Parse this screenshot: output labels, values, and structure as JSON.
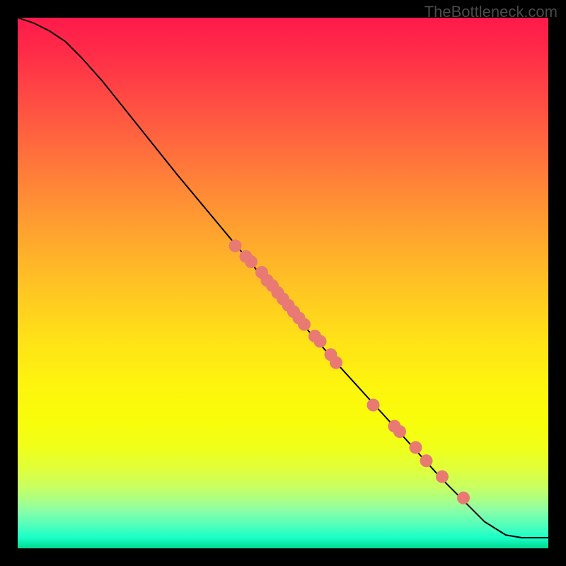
{
  "watermark": "TheBottleneck.com",
  "chart_data": {
    "type": "line",
    "title": "",
    "xlabel": "",
    "ylabel": "",
    "xlim": [
      0,
      100
    ],
    "ylim": [
      0,
      100
    ],
    "curve": {
      "name": "bottleneck-curve",
      "x": [
        0,
        3,
        6,
        9,
        12,
        16,
        22,
        30,
        40,
        50,
        60,
        70,
        80,
        88,
        92,
        95,
        100
      ],
      "y": [
        100,
        99,
        97.5,
        95.5,
        92.5,
        88,
        80.5,
        70.5,
        58.5,
        46.5,
        35,
        24,
        13,
        5,
        2.5,
        2,
        2
      ]
    },
    "points": {
      "name": "component-points",
      "x": [
        41,
        43,
        44,
        46,
        47,
        48,
        49,
        50,
        51,
        52,
        53,
        54,
        56,
        57,
        59,
        60,
        67,
        71,
        72,
        75,
        77,
        80,
        84
      ],
      "y": [
        57,
        55,
        54,
        52,
        50.5,
        49.5,
        48.2,
        47,
        45.8,
        44.6,
        43.4,
        42.2,
        40,
        39,
        36.5,
        35,
        27,
        23,
        22,
        19,
        16.5,
        13.5,
        9.5
      ]
    }
  }
}
